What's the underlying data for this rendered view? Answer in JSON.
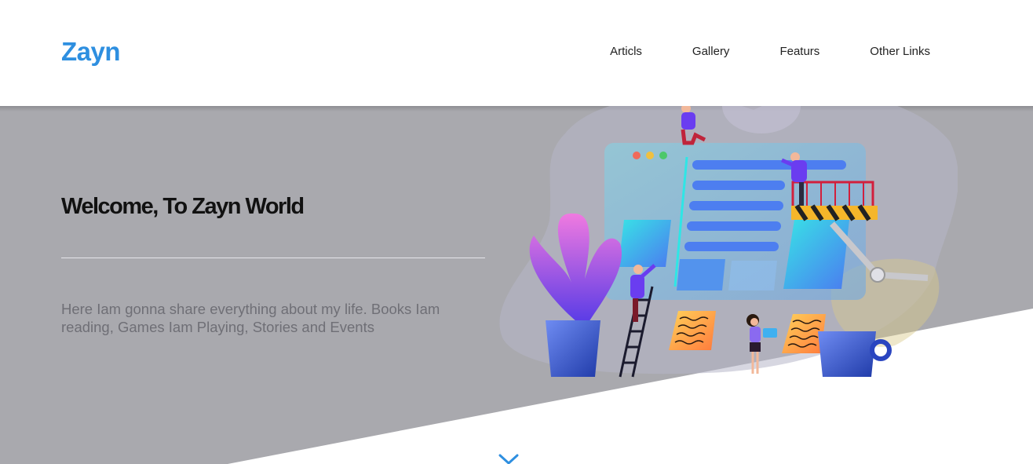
{
  "header": {
    "logo": "Zayn",
    "nav": [
      {
        "label": "Articls"
      },
      {
        "label": "Gallery"
      },
      {
        "label": "Featurs"
      },
      {
        "label": "Other Links"
      }
    ]
  },
  "hero": {
    "title": "Welcome, To Zayn World",
    "description": "Here Iam gonna share everything about my life. Books Iam reading, Games Iam Playing, Stories and Events"
  },
  "colors": {
    "accent": "#2e8fe0",
    "hero_background": "#a9a9ae",
    "text_dark": "#111111",
    "text_muted": "#6f6f76"
  },
  "icons": {
    "scroll_down": "chevron-down-icon"
  }
}
